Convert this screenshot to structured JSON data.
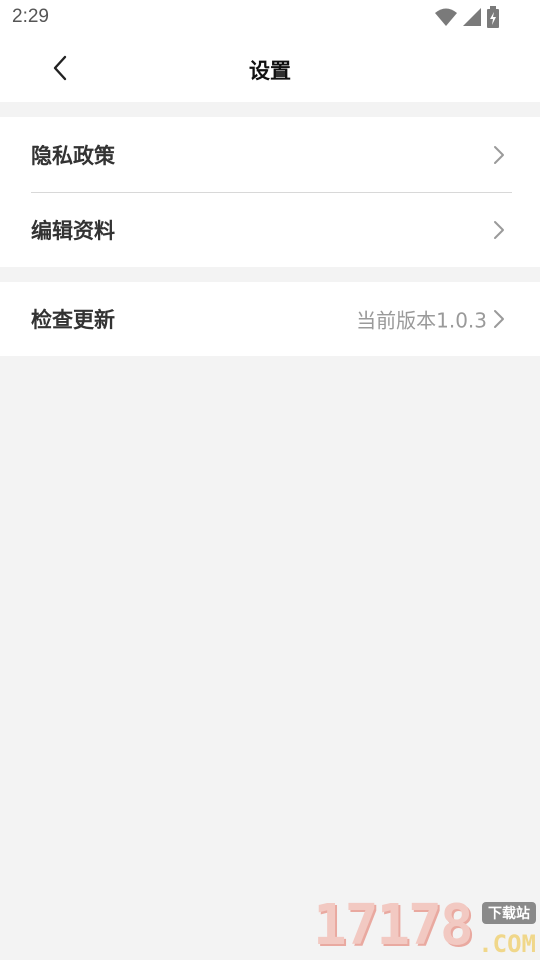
{
  "status_bar": {
    "time": "2:29",
    "icons": [
      "wifi-icon",
      "cellular-signal-icon",
      "battery-charging-icon"
    ]
  },
  "header": {
    "title": "设置",
    "back_icon": "chevron-left-icon"
  },
  "settings": {
    "privacy_policy": {
      "label": "隐私政策"
    },
    "edit_profile": {
      "label": "编辑资料"
    },
    "check_update": {
      "label": "检查更新",
      "value": "当前版本1.0.3"
    }
  },
  "watermark": {
    "digits": "17178",
    "site": "下载站",
    "domain": ".COM"
  },
  "colors": {
    "page_background": "#f3f3f3",
    "card_background": "#ffffff",
    "label_text": "#333333",
    "secondary_text": "#9a9a9a"
  }
}
